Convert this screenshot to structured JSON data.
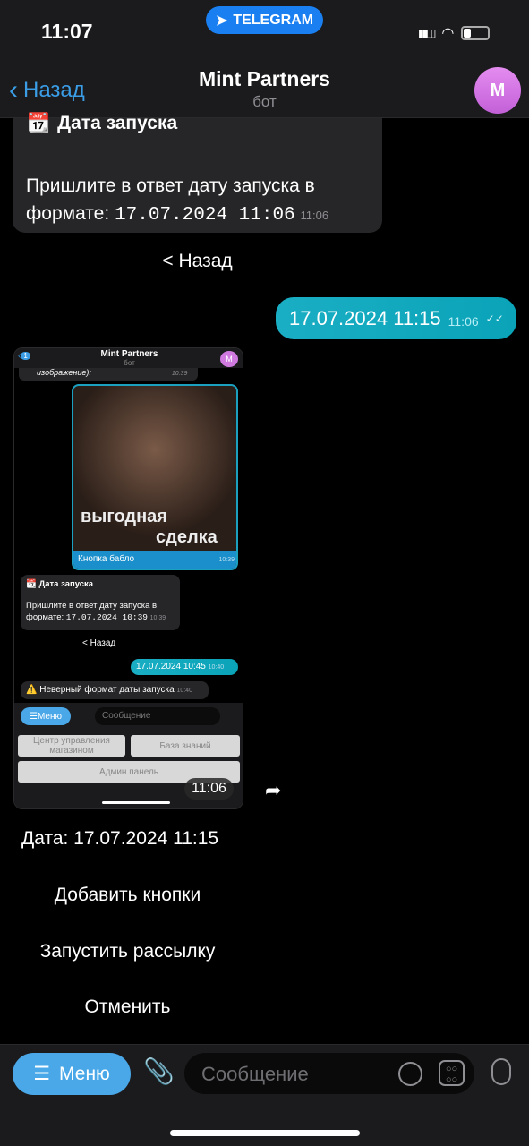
{
  "status": {
    "time": "11:07",
    "app_pill": "TELEGRAM"
  },
  "header": {
    "back": "Назад",
    "title": "Mint Partners",
    "subtitle": "бот",
    "avatar": "M"
  },
  "messages": {
    "m1_title": "Дата запуска",
    "m1_text": "Пришлите в ответ дату запуска в формате:",
    "m1_code": "17.07.2024 11:06",
    "m1_time": "11:06",
    "back_btn": "< Назад",
    "m2_text": "17.07.2024 11:15",
    "m2_time": "11:06",
    "shot_time": "11:06",
    "caption": "Дата: 17.07.2024 11:15",
    "buttons": [
      "Добавить кнопки",
      "Запустить рассылку",
      "Отменить"
    ]
  },
  "screenshot": {
    "back_badge": "1",
    "title": "Mint Partners",
    "subtitle": "бот",
    "avatar": "M",
    "prev_text": "изображение):",
    "prev_time": "10:39",
    "photo_text1": "выгодная",
    "photo_text2": "сделка",
    "photo_caption": "Кнопка бабло",
    "photo_time": "10:39",
    "m_title": "Дата запуска",
    "m_text": "Пришлите в ответ дату запуска в формате:",
    "m_code": "17.07.2024 10:39",
    "m_time": "10:39",
    "back_btn": "< Назад",
    "out_text": "17.07.2024 10:45",
    "out_time": "10:40",
    "warn_text": "Неверный формат даты запуска",
    "warn_time": "10:40",
    "menu": "Меню",
    "placeholder": "Сообщение",
    "kb": [
      "Центр управления магазином",
      "База знаний",
      "Админ панель"
    ]
  },
  "input": {
    "menu": "Меню",
    "placeholder": "Сообщение"
  },
  "colors": {
    "accent": "#3a9de6",
    "outgoing": "#1aaec4",
    "menu_btn": "#4aa8e8"
  }
}
